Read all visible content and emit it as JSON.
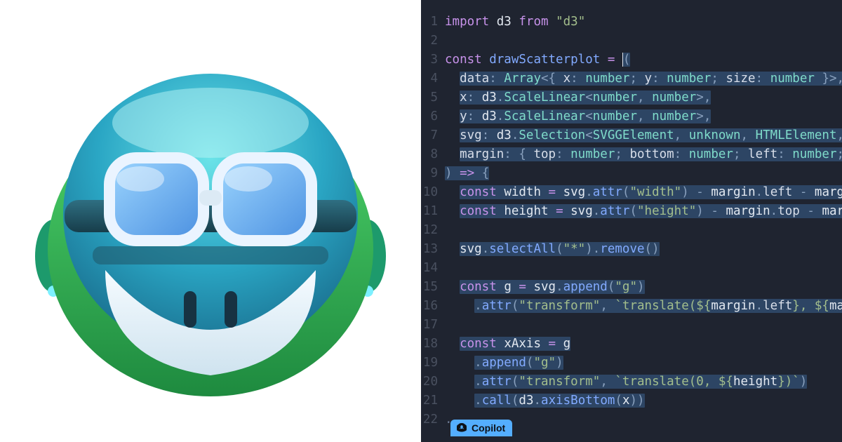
{
  "copilot_label": "Copilot",
  "code": {
    "lines": [
      {
        "n": 1,
        "sel": false,
        "tokens": [
          {
            "t": "import",
            "c": "kw"
          },
          {
            "t": " "
          },
          {
            "t": "d3",
            "c": "id"
          },
          {
            "t": " "
          },
          {
            "t": "from",
            "c": "kw"
          },
          {
            "t": " "
          },
          {
            "t": "\"d3\"",
            "c": "str"
          }
        ]
      },
      {
        "n": 2,
        "sel": false,
        "tokens": []
      },
      {
        "n": 3,
        "sel": "partial",
        "tokens": [
          {
            "t": "const",
            "c": "kw"
          },
          {
            "t": " "
          },
          {
            "t": "drawScatterplot",
            "c": "fn"
          },
          {
            "t": " "
          },
          {
            "t": "=",
            "c": "op"
          },
          {
            "t": " "
          },
          {
            "t": "(",
            "c": "punct",
            "sel": true
          }
        ]
      },
      {
        "n": 4,
        "sel": true,
        "indent": 1,
        "tokens": [
          {
            "t": "data",
            "c": "prop"
          },
          {
            "t": ": ",
            "c": "punct"
          },
          {
            "t": "Array",
            "c": "type"
          },
          {
            "t": "<{ ",
            "c": "punct"
          },
          {
            "t": "x",
            "c": "prop"
          },
          {
            "t": ": ",
            "c": "punct"
          },
          {
            "t": "number",
            "c": "type"
          },
          {
            "t": "; ",
            "c": "punct"
          },
          {
            "t": "y",
            "c": "prop"
          },
          {
            "t": ": ",
            "c": "punct"
          },
          {
            "t": "number",
            "c": "type"
          },
          {
            "t": "; ",
            "c": "punct"
          },
          {
            "t": "size",
            "c": "prop"
          },
          {
            "t": ": ",
            "c": "punct"
          },
          {
            "t": "number",
            "c": "type"
          },
          {
            "t": " }>,",
            "c": "punct"
          }
        ]
      },
      {
        "n": 5,
        "sel": true,
        "indent": 1,
        "tokens": [
          {
            "t": "x",
            "c": "prop"
          },
          {
            "t": ": ",
            "c": "punct"
          },
          {
            "t": "d3",
            "c": "id"
          },
          {
            "t": ".",
            "c": "punct"
          },
          {
            "t": "ScaleLinear",
            "c": "type"
          },
          {
            "t": "<",
            "c": "punct"
          },
          {
            "t": "number",
            "c": "type"
          },
          {
            "t": ", ",
            "c": "punct"
          },
          {
            "t": "number",
            "c": "type"
          },
          {
            "t": ">,",
            "c": "punct"
          }
        ]
      },
      {
        "n": 6,
        "sel": true,
        "indent": 1,
        "tokens": [
          {
            "t": "y",
            "c": "prop"
          },
          {
            "t": ": ",
            "c": "punct"
          },
          {
            "t": "d3",
            "c": "id"
          },
          {
            "t": ".",
            "c": "punct"
          },
          {
            "t": "ScaleLinear",
            "c": "type"
          },
          {
            "t": "<",
            "c": "punct"
          },
          {
            "t": "number",
            "c": "type"
          },
          {
            "t": ", ",
            "c": "punct"
          },
          {
            "t": "number",
            "c": "type"
          },
          {
            "t": ">,",
            "c": "punct"
          }
        ]
      },
      {
        "n": 7,
        "sel": true,
        "indent": 1,
        "tokens": [
          {
            "t": "svg",
            "c": "prop"
          },
          {
            "t": ": ",
            "c": "punct"
          },
          {
            "t": "d3",
            "c": "id"
          },
          {
            "t": ".",
            "c": "punct"
          },
          {
            "t": "Selection",
            "c": "type"
          },
          {
            "t": "<",
            "c": "punct"
          },
          {
            "t": "SVGGElement",
            "c": "type"
          },
          {
            "t": ", ",
            "c": "punct"
          },
          {
            "t": "unknown",
            "c": "type"
          },
          {
            "t": ", ",
            "c": "punct"
          },
          {
            "t": "HTMLElement",
            "c": "type"
          },
          {
            "t": ",",
            "c": "punct"
          }
        ]
      },
      {
        "n": 8,
        "sel": true,
        "indent": 1,
        "tokens": [
          {
            "t": "margin",
            "c": "prop"
          },
          {
            "t": ": { ",
            "c": "punct"
          },
          {
            "t": "top",
            "c": "prop"
          },
          {
            "t": ": ",
            "c": "punct"
          },
          {
            "t": "number",
            "c": "type"
          },
          {
            "t": "; ",
            "c": "punct"
          },
          {
            "t": "bottom",
            "c": "prop"
          },
          {
            "t": ": ",
            "c": "punct"
          },
          {
            "t": "number",
            "c": "type"
          },
          {
            "t": "; ",
            "c": "punct"
          },
          {
            "t": "left",
            "c": "prop"
          },
          {
            "t": ": ",
            "c": "punct"
          },
          {
            "t": "number",
            "c": "type"
          },
          {
            "t": ";",
            "c": "punct"
          }
        ]
      },
      {
        "n": 9,
        "sel": true,
        "tokens": [
          {
            "t": ") ",
            "c": "punct"
          },
          {
            "t": "=>",
            "c": "op"
          },
          {
            "t": " {",
            "c": "punct"
          }
        ]
      },
      {
        "n": 10,
        "sel": true,
        "indent": 1,
        "tokens": [
          {
            "t": "const",
            "c": "kw"
          },
          {
            "t": " "
          },
          {
            "t": "width",
            "c": "id"
          },
          {
            "t": " = ",
            "c": "op"
          },
          {
            "t": "svg",
            "c": "id"
          },
          {
            "t": ".",
            "c": "punct"
          },
          {
            "t": "attr",
            "c": "fn"
          },
          {
            "t": "(",
            "c": "punct"
          },
          {
            "t": "\"width\"",
            "c": "str"
          },
          {
            "t": ") - ",
            "c": "punct"
          },
          {
            "t": "margin",
            "c": "id"
          },
          {
            "t": ".",
            "c": "punct"
          },
          {
            "t": "left",
            "c": "prop"
          },
          {
            "t": " - ",
            "c": "punct"
          },
          {
            "t": "marg",
            "c": "id"
          }
        ]
      },
      {
        "n": 11,
        "sel": true,
        "indent": 1,
        "tokens": [
          {
            "t": "const",
            "c": "kw"
          },
          {
            "t": " "
          },
          {
            "t": "height",
            "c": "id"
          },
          {
            "t": " = ",
            "c": "op"
          },
          {
            "t": "svg",
            "c": "id"
          },
          {
            "t": ".",
            "c": "punct"
          },
          {
            "t": "attr",
            "c": "fn"
          },
          {
            "t": "(",
            "c": "punct"
          },
          {
            "t": "\"height\"",
            "c": "str"
          },
          {
            "t": ") - ",
            "c": "punct"
          },
          {
            "t": "margin",
            "c": "id"
          },
          {
            "t": ".",
            "c": "punct"
          },
          {
            "t": "top",
            "c": "prop"
          },
          {
            "t": " - ",
            "c": "punct"
          },
          {
            "t": "mar",
            "c": "id"
          }
        ]
      },
      {
        "n": 12,
        "sel": false,
        "tokens": []
      },
      {
        "n": 13,
        "sel": true,
        "indent": 1,
        "tokens": [
          {
            "t": "svg",
            "c": "id"
          },
          {
            "t": ".",
            "c": "punct"
          },
          {
            "t": "selectAll",
            "c": "fn"
          },
          {
            "t": "(",
            "c": "punct"
          },
          {
            "t": "\"*\"",
            "c": "str"
          },
          {
            "t": ").",
            "c": "punct"
          },
          {
            "t": "remove",
            "c": "fn"
          },
          {
            "t": "()",
            "c": "punct"
          }
        ]
      },
      {
        "n": 14,
        "sel": false,
        "tokens": []
      },
      {
        "n": 15,
        "sel": true,
        "indent": 1,
        "tokens": [
          {
            "t": "const",
            "c": "kw"
          },
          {
            "t": " "
          },
          {
            "t": "g",
            "c": "id"
          },
          {
            "t": " = ",
            "c": "op"
          },
          {
            "t": "svg",
            "c": "id"
          },
          {
            "t": ".",
            "c": "punct"
          },
          {
            "t": "append",
            "c": "fn"
          },
          {
            "t": "(",
            "c": "punct"
          },
          {
            "t": "\"g\"",
            "c": "str"
          },
          {
            "t": ")",
            "c": "punct"
          }
        ]
      },
      {
        "n": 16,
        "sel": true,
        "indent": 2,
        "tokens": [
          {
            "t": ".",
            "c": "punct"
          },
          {
            "t": "attr",
            "c": "fn"
          },
          {
            "t": "(",
            "c": "punct"
          },
          {
            "t": "\"transform\"",
            "c": "str"
          },
          {
            "t": ", ",
            "c": "punct"
          },
          {
            "t": "`translate(${",
            "c": "str"
          },
          {
            "t": "margin",
            "c": "id"
          },
          {
            "t": ".",
            "c": "punct"
          },
          {
            "t": "left",
            "c": "prop"
          },
          {
            "t": "}, ${",
            "c": "str"
          },
          {
            "t": "ma",
            "c": "id"
          }
        ]
      },
      {
        "n": 17,
        "sel": false,
        "tokens": []
      },
      {
        "n": 18,
        "sel": true,
        "indent": 1,
        "tokens": [
          {
            "t": "const",
            "c": "kw"
          },
          {
            "t": " "
          },
          {
            "t": "xAxis",
            "c": "id"
          },
          {
            "t": " = ",
            "c": "op"
          },
          {
            "t": "g",
            "c": "id"
          }
        ]
      },
      {
        "n": 19,
        "sel": true,
        "indent": 2,
        "tokens": [
          {
            "t": ".",
            "c": "punct"
          },
          {
            "t": "append",
            "c": "fn"
          },
          {
            "t": "(",
            "c": "punct"
          },
          {
            "t": "\"g\"",
            "c": "str"
          },
          {
            "t": ")",
            "c": "punct"
          }
        ]
      },
      {
        "n": 20,
        "sel": true,
        "indent": 2,
        "tokens": [
          {
            "t": ".",
            "c": "punct"
          },
          {
            "t": "attr",
            "c": "fn"
          },
          {
            "t": "(",
            "c": "punct"
          },
          {
            "t": "\"transform\"",
            "c": "str"
          },
          {
            "t": ", ",
            "c": "punct"
          },
          {
            "t": "`translate(0, ${",
            "c": "str"
          },
          {
            "t": "height",
            "c": "id"
          },
          {
            "t": "})`",
            "c": "str"
          },
          {
            "t": ")",
            "c": "punct"
          }
        ]
      },
      {
        "n": 21,
        "sel": true,
        "indent": 2,
        "tokens": [
          {
            "t": ".",
            "c": "punct"
          },
          {
            "t": "call",
            "c": "fn"
          },
          {
            "t": "(",
            "c": "punct"
          },
          {
            "t": "d3",
            "c": "id"
          },
          {
            "t": ".",
            "c": "punct"
          },
          {
            "t": "axisBottom",
            "c": "fn"
          },
          {
            "t": "(",
            "c": "punct"
          },
          {
            "t": "x",
            "c": "id"
          },
          {
            "t": "))",
            "c": "punct"
          }
        ]
      },
      {
        "n": 22,
        "sel": false,
        "indent": 0,
        "tokens": [
          {
            "t": "...",
            "c": "dim"
          }
        ]
      }
    ]
  }
}
